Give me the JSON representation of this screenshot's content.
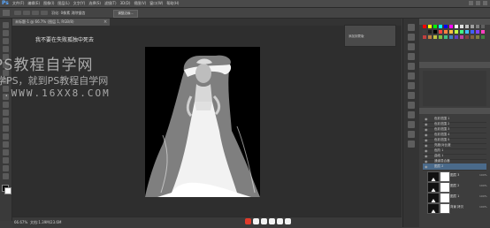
{
  "app": {
    "logo": "Ps"
  },
  "menubar": {
    "items": [
      "文件(F)",
      "编辑(E)",
      "图像(I)",
      "图层(L)",
      "文字(Y)",
      "选择(S)",
      "滤镜(T)",
      "3D(D)",
      "视图(V)",
      "窗口(W)",
      "帮助(H)"
    ]
  },
  "options": {
    "text": "羽化: 0像素  消除锯齿",
    "refine_label": "调整边缘..."
  },
  "document": {
    "tab_title": "未标题-1 @ 66.7% (图层 1, RGB/8)",
    "close_glyph": "×"
  },
  "canvas": {
    "headline": "我不要在失败孤独中死去",
    "watermark": {
      "brand": "PS教程自学网",
      "sub": "学PS，就到PS教程自学网",
      "url": ".WWW.16XX8.COM"
    }
  },
  "float_panel": {
    "item": "添加到蒙版"
  },
  "status": {
    "zoom": "66.67%",
    "doc": "文档:1.39M/23.6M"
  },
  "colors": {
    "accent": "#5aa8ff",
    "selected_layer": "#4a6a8a",
    "canvas_bg": "#000000"
  },
  "swatch_colors": [
    "#ff0000",
    "#ffff00",
    "#00ff00",
    "#00ffff",
    "#0000ff",
    "#ff00ff",
    "#ffffff",
    "#e0e0e0",
    "#c0c0c0",
    "#a0a0a0",
    "#808080",
    "#606060",
    "#404040",
    "#202020",
    "#000000",
    "#ff4040",
    "#ff8040",
    "#ffc040",
    "#c0ff40",
    "#40ff80",
    "#40c0ff",
    "#4060ff",
    "#8040ff",
    "#ff40c0",
    "#c04040",
    "#c08040",
    "#c0c040",
    "#80c040",
    "#40c080",
    "#4080c0",
    "#6040c0",
    "#c040a0",
    "#804040",
    "#806040",
    "#808040",
    "#408040"
  ],
  "layers": {
    "rows": [
      {
        "label": "色彩范围 1"
      },
      {
        "label": "色彩范围 2"
      },
      {
        "label": "色彩范围 3"
      },
      {
        "label": "色彩范围 4"
      },
      {
        "label": "色彩范围 5"
      },
      {
        "label": "亮度/对比度"
      },
      {
        "label": "色阶 1"
      },
      {
        "label": "曲线 1"
      },
      {
        "label": "通道混合器"
      },
      {
        "label": "图层 2"
      }
    ],
    "thumbs": [
      {
        "label": "图层 3",
        "opacity": "100%"
      },
      {
        "label": "图层 2",
        "opacity": "100%"
      },
      {
        "label": "图层 1",
        "opacity": "100%"
      },
      {
        "label": "背景 拷贝",
        "opacity": "100%"
      }
    ]
  }
}
